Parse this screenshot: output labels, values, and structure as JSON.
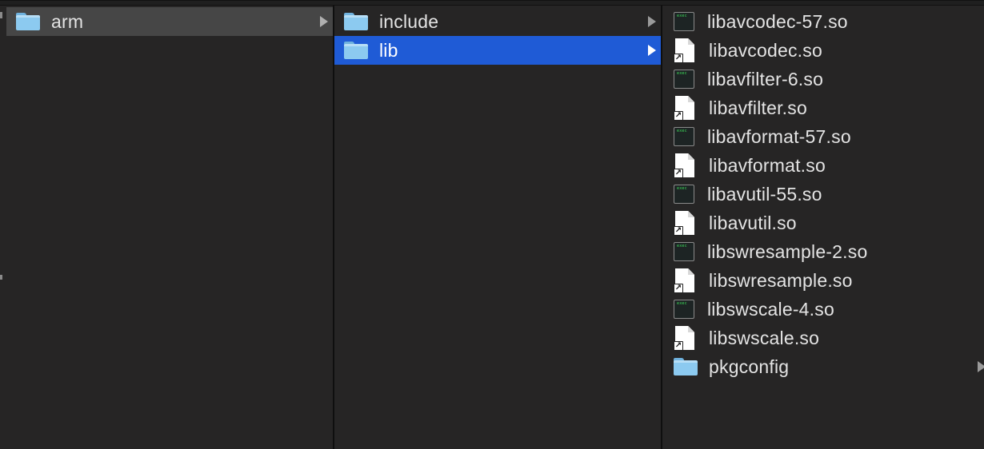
{
  "columns": [
    {
      "items": [
        {
          "label": "arm",
          "icon": "folder-icon",
          "state": "selected-inactive",
          "has_children": true
        }
      ]
    },
    {
      "items": [
        {
          "label": "include",
          "icon": "folder-icon",
          "state": "normal",
          "has_children": true
        },
        {
          "label": "lib",
          "icon": "folder-icon",
          "state": "selected-active",
          "has_children": true
        }
      ]
    },
    {
      "items": [
        {
          "label": "libavcodec-57.so",
          "icon": "executable-icon"
        },
        {
          "label": "libavcodec.so",
          "icon": "alias-document-icon"
        },
        {
          "label": "libavfilter-6.so",
          "icon": "executable-icon"
        },
        {
          "label": "libavfilter.so",
          "icon": "alias-document-icon"
        },
        {
          "label": "libavformat-57.so",
          "icon": "executable-icon"
        },
        {
          "label": "libavformat.so",
          "icon": "alias-document-icon"
        },
        {
          "label": "libavutil-55.so",
          "icon": "executable-icon"
        },
        {
          "label": "libavutil.so",
          "icon": "alias-document-icon"
        },
        {
          "label": "libswresample-2.so",
          "icon": "executable-icon"
        },
        {
          "label": "libswresample.so",
          "icon": "alias-document-icon"
        },
        {
          "label": "libswscale-4.so",
          "icon": "executable-icon"
        },
        {
          "label": "libswscale.so",
          "icon": "alias-document-icon"
        },
        {
          "label": "pkgconfig",
          "icon": "folder-icon",
          "has_children": true
        }
      ]
    }
  ],
  "icons": {
    "exec_text": "exec",
    "alias_glyph": "↗"
  },
  "colors": {
    "background": "#262525",
    "selection_active": "#1f5bd6",
    "selection_inactive": "#464646",
    "folder": "#8ccaf0",
    "text": "#e4e4e4"
  }
}
